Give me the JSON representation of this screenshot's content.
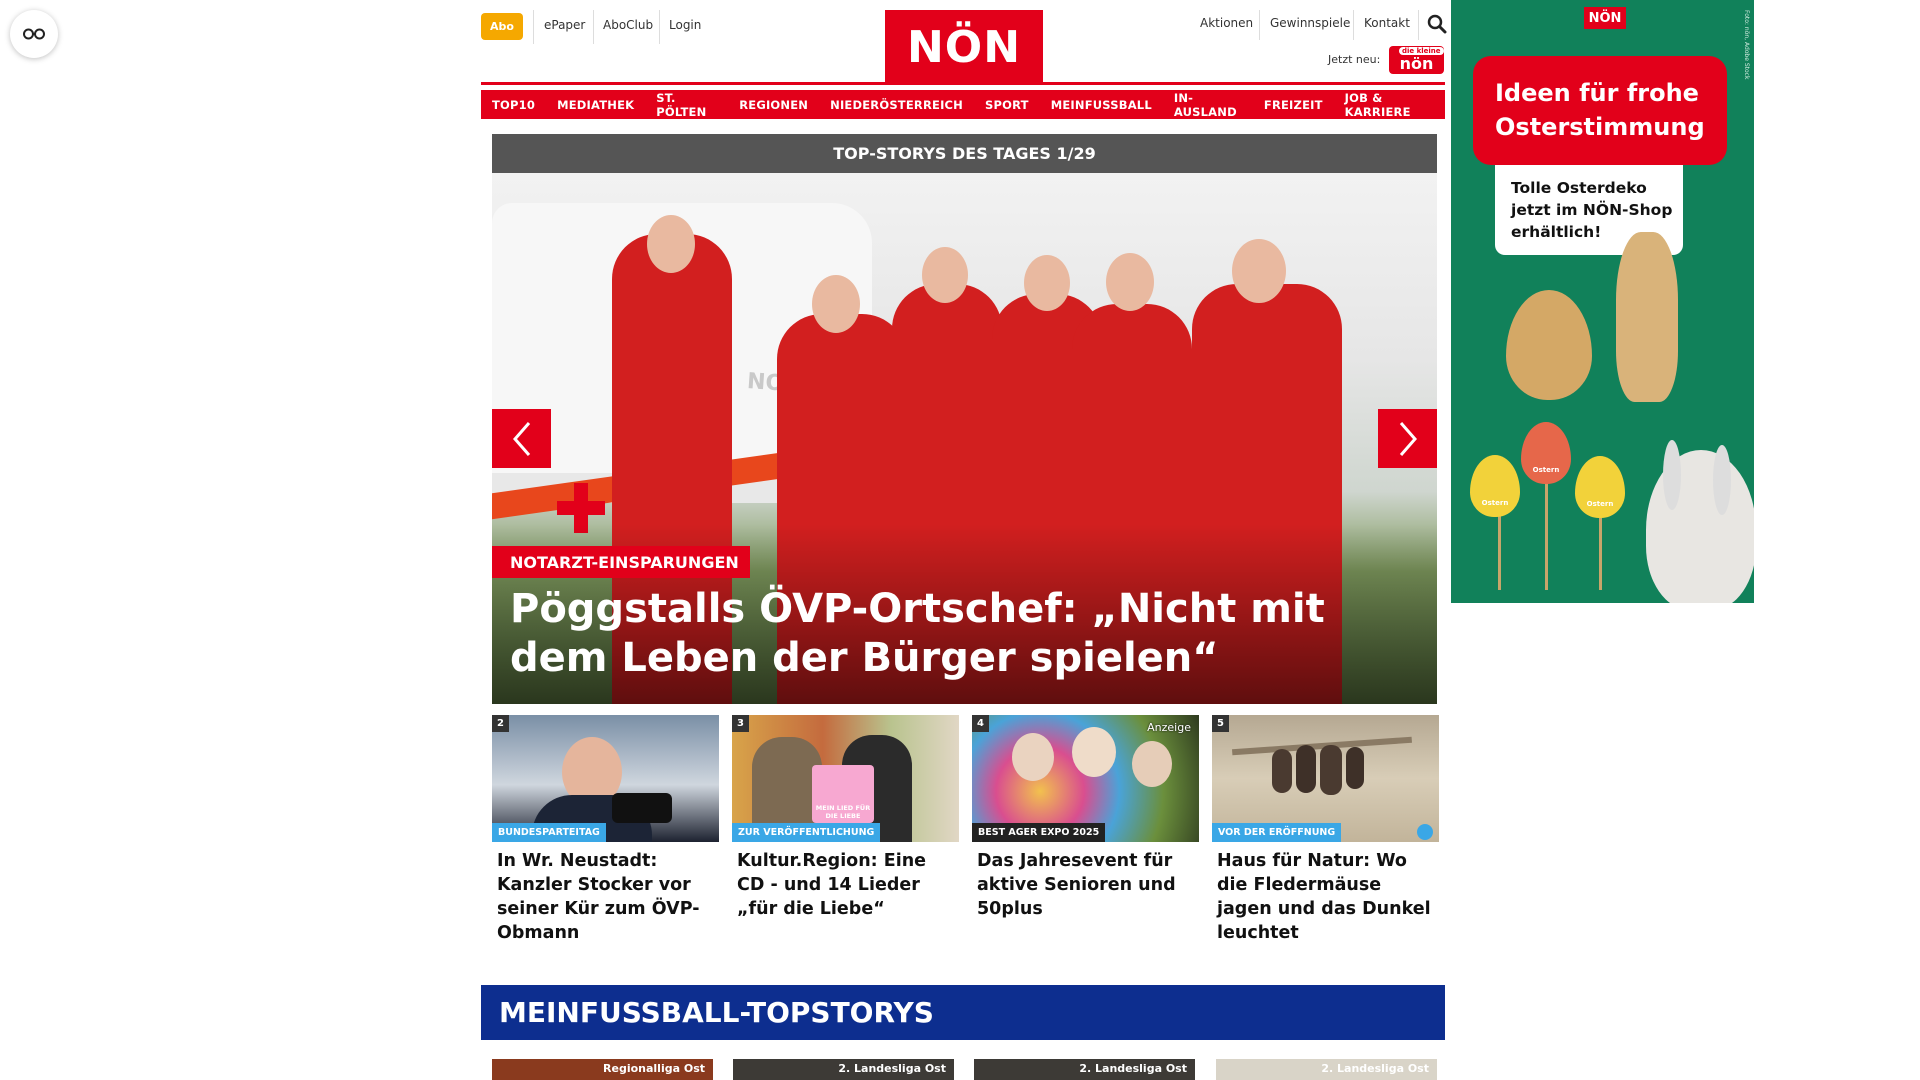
{
  "header": {
    "abo": "Abo",
    "links_left": [
      "ePaper",
      "AboClub",
      "Login"
    ],
    "logo": "NÖN",
    "links_right": [
      "Aktionen",
      "Gewinnspiele",
      "Kontakt"
    ],
    "jetzt_neu": "Jetzt neu:",
    "sticker": "nön",
    "sticker_small": "die kleine"
  },
  "nav": [
    "TOP10",
    "MEDIATHEK",
    "ST. PÖLTEN",
    "REGIONEN",
    "NIEDERÖSTERREICH",
    "SPORT",
    "MEINFUSSBALL",
    "IN-AUSLAND",
    "FREIZEIT",
    "JOB & KARRIERE"
  ],
  "topstories": {
    "header": "TOP-STORYS DES TAGES 1/29",
    "hero_kicker": "NOTARZT-EINSPARUNGEN",
    "hero_title": "Pöggstalls ÖVP-Ortschef: „Nicht mit dem Leben der Bürger spielen“",
    "van_text": "NOTARZT",
    "cards": [
      {
        "num": "2",
        "tag": "BUNDESPARTEITAG",
        "title": "In Wr. Neustadt: Kanzler Stocker vor seiner Kür zum ÖVP-Obmann"
      },
      {
        "num": "3",
        "tag": "ZUR VERÖFFENTLICHUNG",
        "title": "Kultur.Region: Eine CD - und 14 Lieder „für die Liebe“",
        "sign": "MEIN LIED FÜR DIE LIEBE"
      },
      {
        "num": "4",
        "tag": "BEST AGER EXPO 2025",
        "title": "Das Jahresevent für aktive Senioren und 50plus",
        "anzeige": "Anzeige"
      },
      {
        "num": "5",
        "tag": "VOR DER ERÖFFNUNG",
        "title": "Haus für Natur: Wo die Fledermäuse jagen und das Dunkel leuchtet"
      }
    ]
  },
  "meinfussball": {
    "header": "MEINFUSSBALL-TOPSTORYS",
    "cards": [
      "Regionalliga Ost",
      "2. Landesliga Ost",
      "2. Landesliga Ost",
      "2. Landesliga Ost"
    ]
  },
  "ad": {
    "logo": "NÖN",
    "headline": "Ideen für frohe Osterstimmung",
    "sub": "Tolle Osterdeko jetzt im NÖN-Shop erhältlich!",
    "egg_text": "Ostern",
    "side_text": "Foto: nön, Adobe Stock"
  },
  "colors": {
    "brand_red": "#e2001a",
    "abo_yellow": "#f5a800",
    "tag_blue": "#3aa7e6",
    "mf_blue": "#0d2e8f",
    "ad_green": "#11815a"
  }
}
